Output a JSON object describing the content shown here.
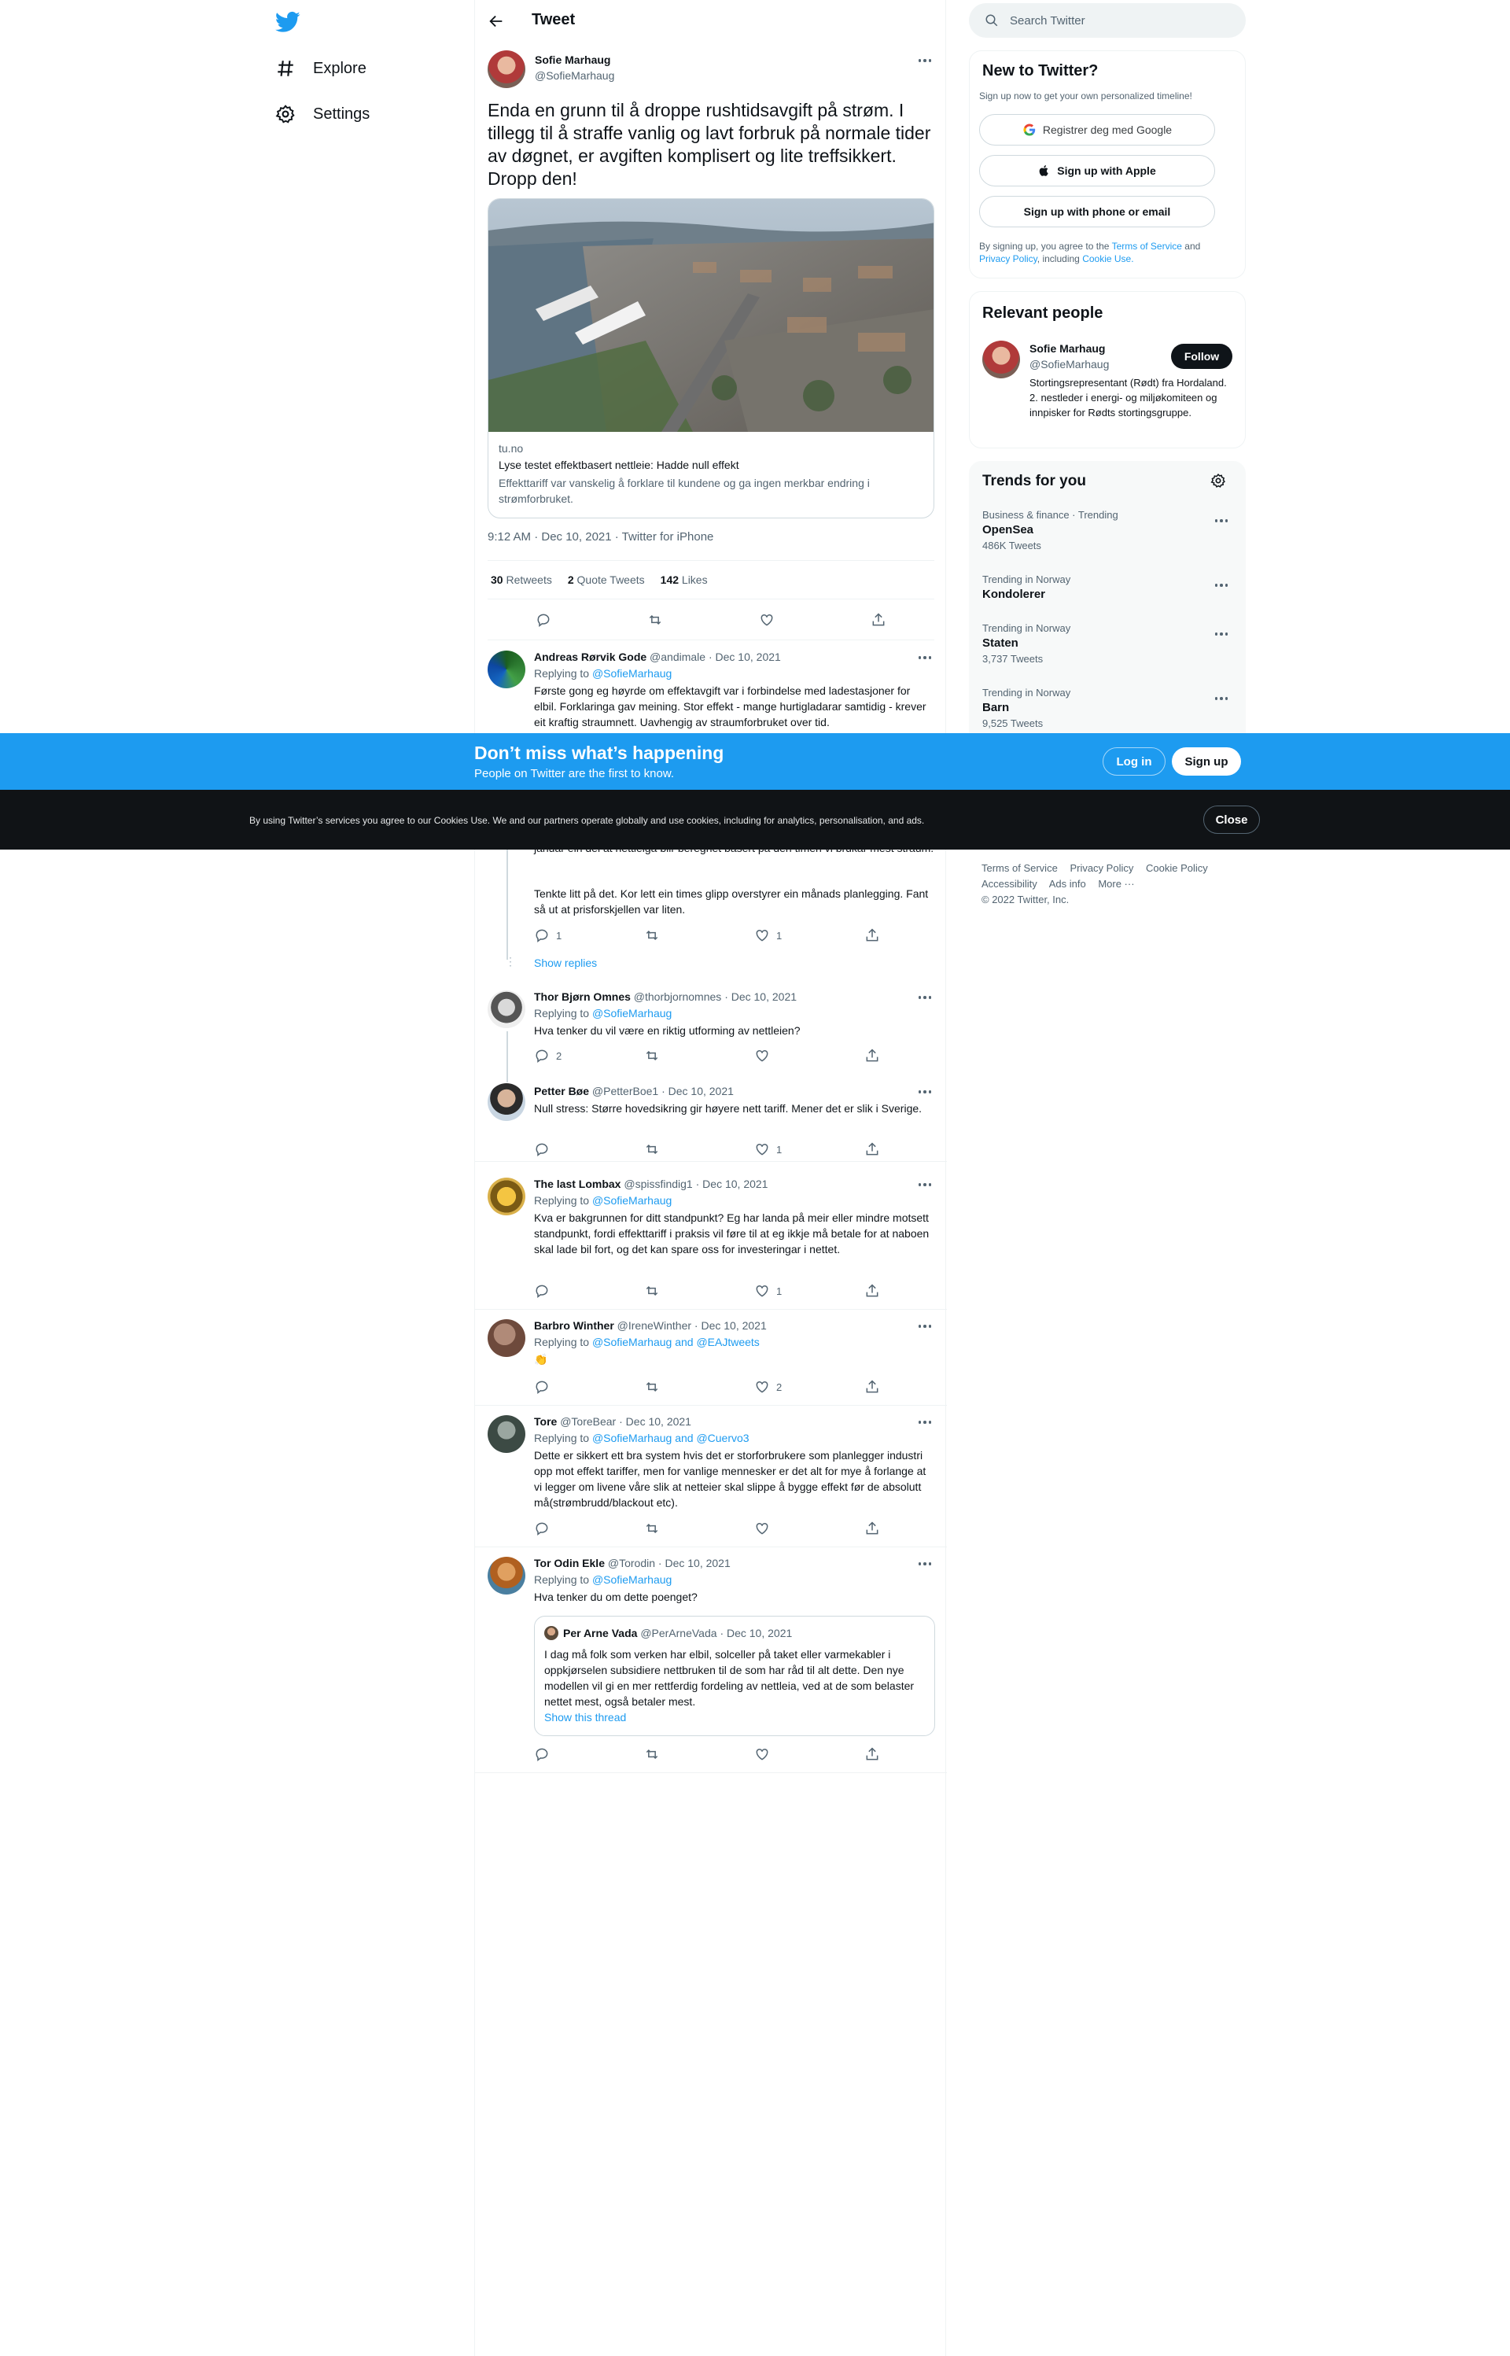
{
  "nav": {
    "explore": "Explore",
    "settings": "Settings"
  },
  "header": {
    "title": "Tweet"
  },
  "tweet": {
    "name": "Sofie Marhaug",
    "handle": "@SofieMarhaug",
    "text": "Enda en grunn til å droppe rushtidsavgift på strøm. I tillegg til å straffe vanlig og lavt forbruk på normale tider av døgnet, er avgiften komplisert og lite treffsikkert. Dropp den!",
    "card": {
      "domain": "tu.no",
      "title": "Lyse testet effektbasert nettleie: Hadde null effekt",
      "description": "Effekttariff var vanskelig å forklare til kundene og ga ingen merkbar endring i strømforbruket."
    },
    "meta": "9:12 AM · Dec 10, 2021 · Twitter for iPhone",
    "retweets": "30",
    "retweets_label": "Retweets",
    "quotes": "2",
    "quotes_label": "Quote Tweets",
    "likes": "142",
    "likes_label": "Likes"
  },
  "replies": [
    {
      "name": "Andreas Rørvik Gode",
      "handle": "@andimale",
      "date": "· Dec 10, 2021",
      "replying_prefix": "Replying to",
      "replying_to": "@SofieMarhaug",
      "text": "Første gong eg høyrde om effektavgift var i forbindelse med ladestasjoner for elbil. Forklaringa gav meining. Stor effekt - mange hurtigladarar samtidig - krever eit kraftig straumnett. Uavhengig av straumforbruket over tid."
    },
    {
      "partial_text": "januar ein dei at nettleiga blir beregnet basert på den timen vi brukar mest straum.",
      "text": "Tenkte litt på det. Kor lett ein times glipp overstyrer ein månads planlegging. Fant så ut at prisforskjellen var liten.",
      "replies": "1",
      "likes": "1",
      "show_replies": "Show replies"
    },
    {
      "name": "Thor Bjørn Omnes",
      "handle": "@thorbjornomnes",
      "date": "· Dec 10, 2021",
      "replying_prefix": "Replying to",
      "replying_to": "@SofieMarhaug",
      "text": "Hva tenker du vil være en riktig utforming av nettleien?",
      "replies": "2"
    },
    {
      "name": "Petter Bøe",
      "handle": "@PetterBoe1",
      "date": "· Dec 10, 2021",
      "text": "Null stress: Større hovedsikring gir høyere nett tariff. Mener det er slik i Sverige.",
      "likes": "1"
    },
    {
      "name": "The last Lombax",
      "handle": "@spissfindig1",
      "date": "· Dec 10, 2021",
      "replying_prefix": "Replying to",
      "replying_to": "@SofieMarhaug",
      "text": "Kva er bakgrunnen for ditt standpunkt? Eg har landa på meir eller mindre motsett standpunkt, fordi effekttariff i praksis vil føre til at eg ikkje må betale for at naboen skal lade bil fort, og det kan spare oss for investeringar i nettet.",
      "likes": "1"
    },
    {
      "name": "Barbro Winther",
      "handle": "@IreneWinther",
      "date": "· Dec 10, 2021",
      "replying_prefix": "Replying to",
      "replying_to": "@SofieMarhaug and @EAJtweets",
      "text": "👏",
      "likes": "2"
    },
    {
      "name": "Tore",
      "handle": "@ToreBear",
      "date": "· Dec 10, 2021",
      "replying_prefix": "Replying to",
      "replying_to": "@SofieMarhaug and @Cuervo3",
      "text": "Dette er sikkert ett bra system hvis det er storforbrukere som planlegger industri opp mot effekt tariffer, men for vanlige mennesker er det alt for mye å forlange at vi legger om livene våre slik at netteier skal slippe å bygge effekt før de absolutt må(strømbrudd/blackout etc)."
    },
    {
      "name": "Tor Odin Ekle",
      "handle": "@Torodin",
      "date": "· Dec 10, 2021",
      "replying_prefix": "Replying to",
      "replying_to": "@SofieMarhaug",
      "text": "Hva tenker du om dette poenget?",
      "quote": {
        "name": "Per Arne Vada",
        "handle": "@PerArneVada",
        "date": "· Dec 10, 2021",
        "text": "I dag må folk som verken har elbil, solceller på taket eller varmekabler i oppkjørselen subsidiere nettbruken til de som har råd til alt dette. Den nye modellen vil gi en mer rettferdig fordeling av nettleia, ved at de som belaster nettet mest, også betaler mest.",
        "show_thread": "Show this thread"
      }
    }
  ],
  "sidebar": {
    "search_placeholder": "Search Twitter",
    "new": {
      "title": "New to Twitter?",
      "subtitle": "Sign up now to get your own personalized timeline!",
      "google": "Registrer deg med Google",
      "apple": "Sign up with Apple",
      "phone": "Sign up with phone or email",
      "terms_1": "By signing up, you agree to the",
      "terms_link": "Terms of Service",
      "terms_2": "and",
      "privacy_link": "Privacy Policy",
      "terms_3": ", including",
      "cookie_link": "Cookie Use."
    },
    "relevant": {
      "title": "Relevant people",
      "name": "Sofie Marhaug",
      "handle": "@SofieMarhaug",
      "follow": "Follow",
      "bio": "Stortingsrepresentant (Rødt) fra Hordaland. 2. nestleder i energi- og miljøkomiteen og innpisker for Rødts stortingsgruppe."
    },
    "trends": {
      "title": "Trends for you",
      "items": [
        {
          "category": "Business & finance · Trending",
          "name": "OpenSea",
          "count": "486K Tweets"
        },
        {
          "category": "Trending in Norway",
          "name": "Kondolerer",
          "count": ""
        },
        {
          "category": "Trending in Norway",
          "name": "Staten",
          "count": "3,737 Tweets"
        },
        {
          "category": "Trending in Norway",
          "name": "Barn",
          "count": "9,525 Tweets"
        }
      ]
    },
    "footer": {
      "tos": "Terms of Service",
      "privacy": "Privacy Policy",
      "cookie": "Cookie Policy",
      "accessibility": "Accessibility",
      "ads": "Ads info",
      "more": "More ···",
      "copyright": "© 2022 Twitter, Inc."
    }
  },
  "banner": {
    "heading": "Don’t miss what’s happening",
    "sub": "People on Twitter are the first to know.",
    "login": "Log in",
    "signup": "Sign up"
  },
  "cookie": {
    "text": "By using Twitter’s services you agree to our Cookies Use. We and our partners operate globally and use cookies, including for analytics, personalisation, and ads.",
    "close": "Close"
  },
  "colors": {
    "accent": "#1d9bf0",
    "text": "#0f1419",
    "muted": "#536471",
    "cookie_bg": "#101316"
  }
}
